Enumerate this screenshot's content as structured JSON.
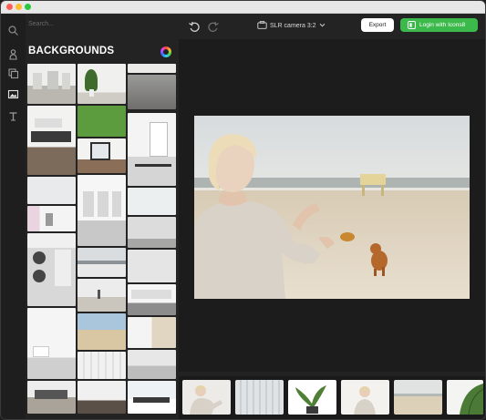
{
  "window": {
    "traffic_lights": [
      "close",
      "minimize",
      "zoom"
    ]
  },
  "rail": {
    "icons": [
      "person-icon",
      "layers-icon",
      "image-icon",
      "text-icon"
    ]
  },
  "sidebar": {
    "search_placeholder": "Search...",
    "section_title": "BACKGROUNDS",
    "color_filter_icon": "color-wheel-icon",
    "thumbnails": [
      "white-room-corridor",
      "plant-room",
      "grey-room",
      "white-room-chairs",
      "white-interior",
      "concrete-wall",
      "bedroom-window",
      "green-grass",
      "white-kitchen",
      "white-cabinet",
      "empty-white-room",
      "grey-floor-room",
      "pink-tiled-room",
      "white-marble-wall",
      "laundry-room",
      "concrete-empty",
      "city-skyline",
      "white-walls",
      "desert-field",
      "white-shelves",
      "white-bathroom",
      "beach-sand",
      "blinds-room",
      "white-radiator",
      "white-cabinet-room",
      "blue-sky-snow"
    ]
  },
  "toolbar": {
    "undo_icon": "undo-icon",
    "redo_icon": "redo-icon",
    "camera_label": "SLR camera  3:2",
    "export_label": "Export",
    "login_label": "Login with Icons8"
  },
  "canvas": {
    "photo_description_icon": "beach-woman-dog-photo"
  },
  "filmstrip": {
    "items": [
      "woman-pointing",
      "blinds-wall",
      "palm-plant",
      "woman-portrait",
      "beach-sand-thumb",
      "palm-leaf"
    ]
  },
  "colors": {
    "accent_green": "#3bb94a",
    "sidebar_bg": "#232323",
    "canvas_bg": "#1c1c1c"
  }
}
